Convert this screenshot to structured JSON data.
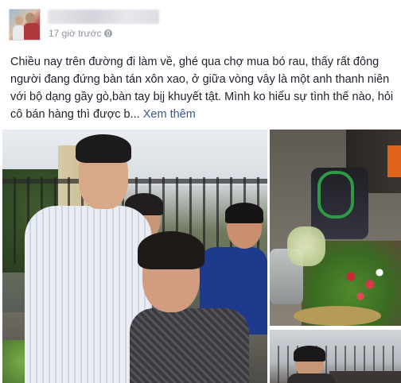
{
  "post": {
    "author_name": "",
    "timestamp": "17 giờ trước",
    "privacy_icon": "globe-icon",
    "text": "Chiều nay trên đường đi làm về, ghé qua chợ mua bó rau, thấy rất đông người đang đứng bàn tán xôn xao, ở giữa vòng vây là một anh thanh niên với bộ dạng gầy gò,bàn tay bịj khuyết tật. Mình ko hiểu sự tình thế nào, hỏi cô bán hàng thì được b...",
    "see_more": "Xem thêm"
  },
  "colors": {
    "link": "#365899",
    "text": "#1d2129",
    "meta": "#90949c"
  },
  "photos": {
    "count": 3
  }
}
